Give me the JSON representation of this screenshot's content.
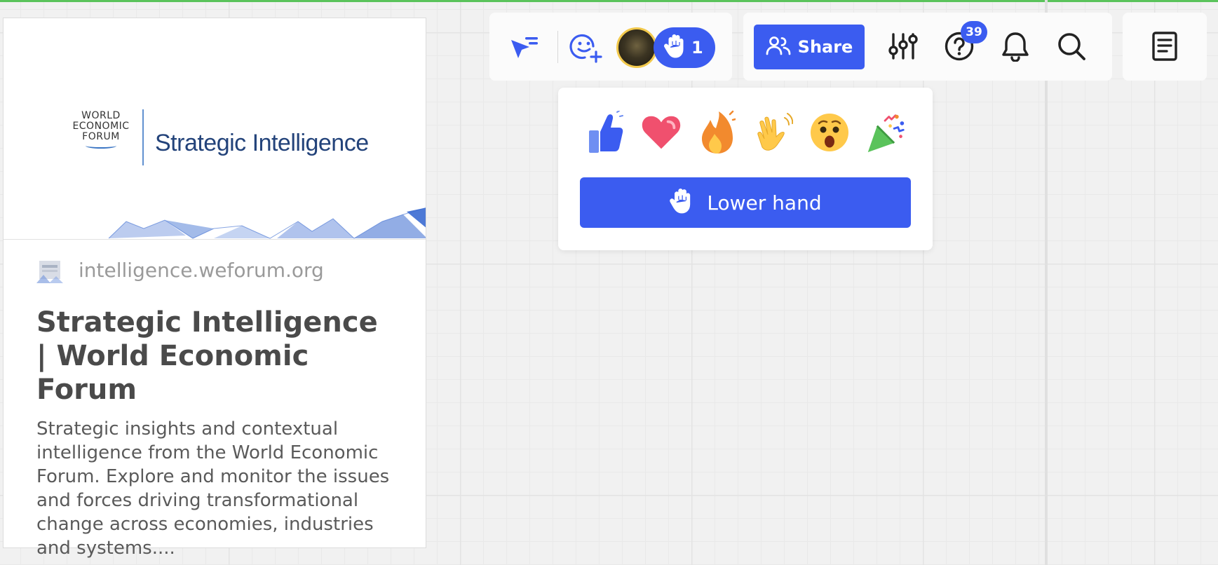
{
  "card": {
    "logo_lines": [
      "WORLD",
      "ECONOMIC",
      "FORUM"
    ],
    "preview_title": "Strategic Intelligence",
    "site_url": "intelligence.weforum.org",
    "title": "Strategic Intelligence | World Economic Forum",
    "description": "Strategic insights and contextual intelligence from the World Economic Forum. Explore and monitor the issues and forces driving transformational change across economies, industries and systems...."
  },
  "collab": {
    "raised_hands_count": "1"
  },
  "toolbar": {
    "share_label": "Share",
    "help_badge": "39"
  },
  "reactions_popup": {
    "reactions": [
      "thumbs-up",
      "heart",
      "fire",
      "waving-hands",
      "surprised-face",
      "party-popper"
    ],
    "lower_hand_label": "Lower hand"
  },
  "colors": {
    "accent": "#3b5cf0",
    "top_line": "#5ac35b",
    "avatar_ring": "#f2c94c"
  }
}
